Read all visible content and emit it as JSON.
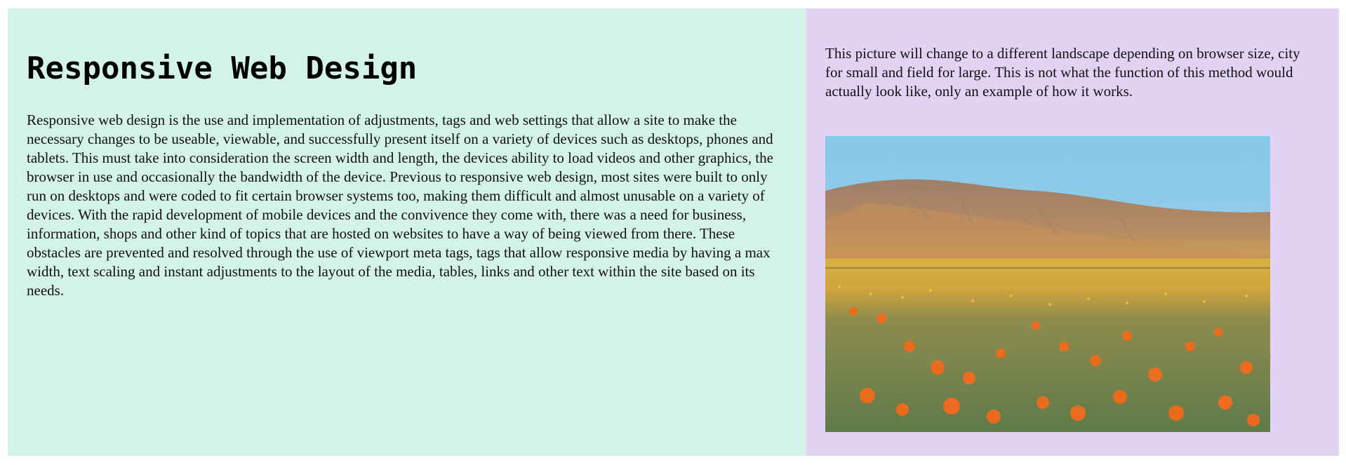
{
  "main": {
    "title": "Responsive Web Design",
    "paragraph": "Responsive web design is the use and implementation of adjustments, tags and web settings that allow a site to make the necessary changes to be useable, viewable, and successfully present itself on a variety of devices such as desktops, phones and tablets. This must take into consideration the screen width and length, the devices ability to load videos and other graphics, the browser in use and occasionally the bandwidth of the device. Previous to responsive web design, most sites were built to only run on desktops and were coded to fit certain browser systems too, making them difficult and almost unusable on a variety of devices. With the rapid development of mobile devices and the convivence they come with, there was a need for business, information, shops and other kind of topics that are hosted on websites to have a way of being viewed from there. These obstacles are prevented and resolved through the use of viewport meta tags, tags that allow responsive media by having a max width, text scaling and instant adjustments to the layout of the media, tables, links and other text within the site based on its needs."
  },
  "side": {
    "caption": "This picture will change to a different landscape depending on browser size, city for small and field for large. This is not what the function of this method would actually look like, only an example of how it works.",
    "image_icon": "poppy-field-landscape"
  },
  "colors": {
    "main_background": "#d4f3e8",
    "side_background": "#e2d3f5",
    "sky": "#8fcbe6",
    "hill": "#b08a6a",
    "poppy": "#f26a1b",
    "grass": "#6f8c5a"
  }
}
